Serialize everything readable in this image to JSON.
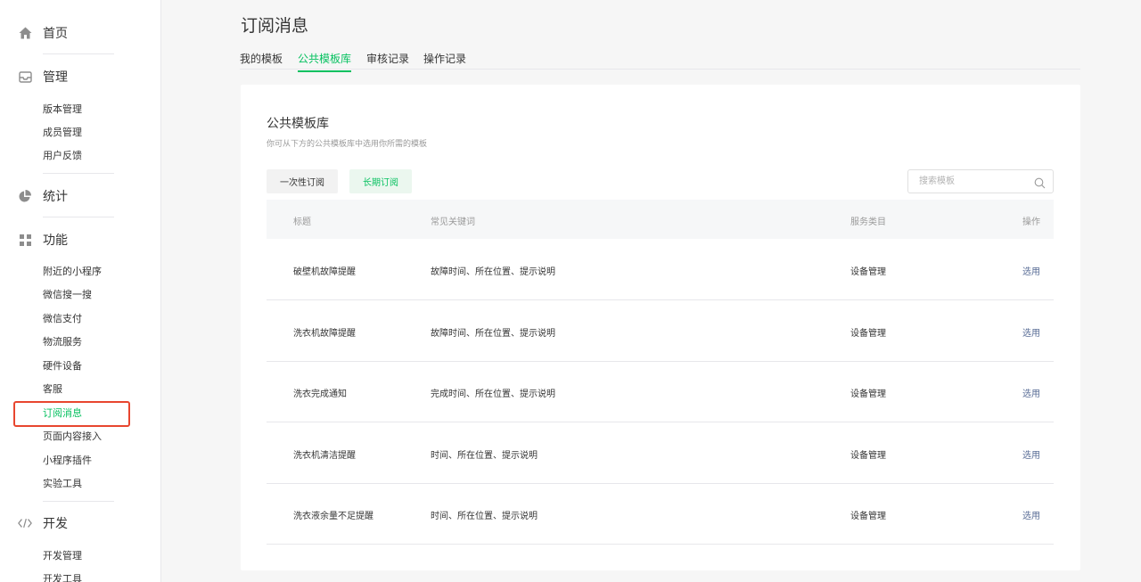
{
  "sidebar": {
    "home": "首页",
    "manage": {
      "title": "管理",
      "items": [
        "版本管理",
        "成员管理",
        "用户反馈"
      ]
    },
    "stats": "统计",
    "features": {
      "title": "功能",
      "items": [
        "附近的小程序",
        "微信搜一搜",
        "微信支付",
        "物流服务",
        "硬件设备",
        "客服",
        "订阅消息",
        "页面内容接入",
        "小程序插件",
        "实验工具"
      ]
    },
    "dev": {
      "title": "开发",
      "items": [
        "开发管理",
        "开发工具"
      ]
    }
  },
  "page": {
    "title": "订阅消息",
    "tabs": [
      "我的模板",
      "公共模板库",
      "审核记录",
      "操作记录"
    ],
    "active_tab": "公共模板库"
  },
  "card": {
    "title": "公共模板库",
    "desc": "你可从下方的公共模板库中选用你所需的模板",
    "btn_once": "一次性订阅",
    "btn_long": "长期订阅",
    "search_placeholder": "搜索模板"
  },
  "table": {
    "headers": [
      "标题",
      "常见关键词",
      "服务类目",
      "操作"
    ],
    "rows": [
      {
        "title": "破壁机故障提醒",
        "keywords": "故障时间、所在位置、提示说明",
        "category": "设备管理",
        "action": "选用"
      },
      {
        "title": "洗衣机故障提醒",
        "keywords": "故障时间、所在位置、提示说明",
        "category": "设备管理",
        "action": "选用"
      },
      {
        "title": "洗衣完成通知",
        "keywords": "完成时间、所在位置、提示说明",
        "category": "设备管理",
        "action": "选用"
      },
      {
        "title": "洗衣机清洁提醒",
        "keywords": "时间、所在位置、提示说明",
        "category": "设备管理",
        "action": "选用"
      },
      {
        "title": "洗衣液余量不足提醒",
        "keywords": "时间、所在位置、提示说明",
        "category": "设备管理",
        "action": "选用"
      }
    ]
  },
  "colors": {
    "accent": "#07c160",
    "link": "#576b95",
    "highlight_border": "#e8462f"
  }
}
